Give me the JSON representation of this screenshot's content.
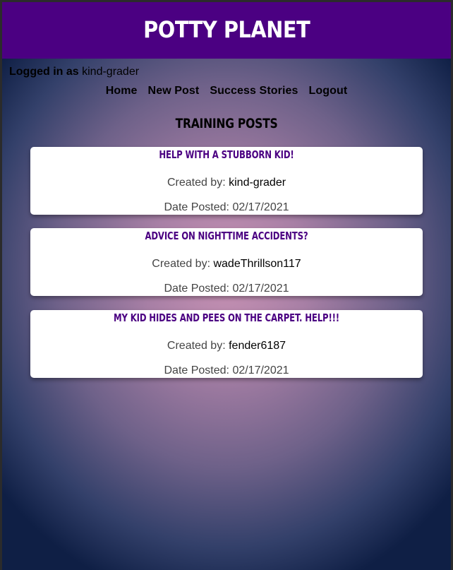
{
  "header": {
    "site_title": "Potty Planet"
  },
  "user": {
    "prefix": "Logged in as",
    "username": "kind-grader"
  },
  "nav": {
    "items": [
      {
        "label": "Home"
      },
      {
        "label": "New Post"
      },
      {
        "label": "Success Stories"
      },
      {
        "label": "Logout"
      }
    ]
  },
  "main": {
    "section_title": "Training Posts",
    "posts": [
      {
        "title": "Help with a stubborn kid!",
        "created_label": "Created by:",
        "author": "kind-grader",
        "date_label": "Date Posted:",
        "date": "02/17/2021"
      },
      {
        "title": "Advice on nighttime accidents?",
        "created_label": "Created by:",
        "author": "wadeThrillson117",
        "date_label": "Date Posted:",
        "date": "02/17/2021"
      },
      {
        "title": "My kid hides and pees on the carpet. Help!!!",
        "created_label": "Created by:",
        "author": "fender6187",
        "date_label": "Date Posted:",
        "date": "02/17/2021"
      }
    ]
  },
  "colors": {
    "header_bg": "#4b0082",
    "post_title": "#4b0082",
    "card_bg": "#ffffff"
  }
}
